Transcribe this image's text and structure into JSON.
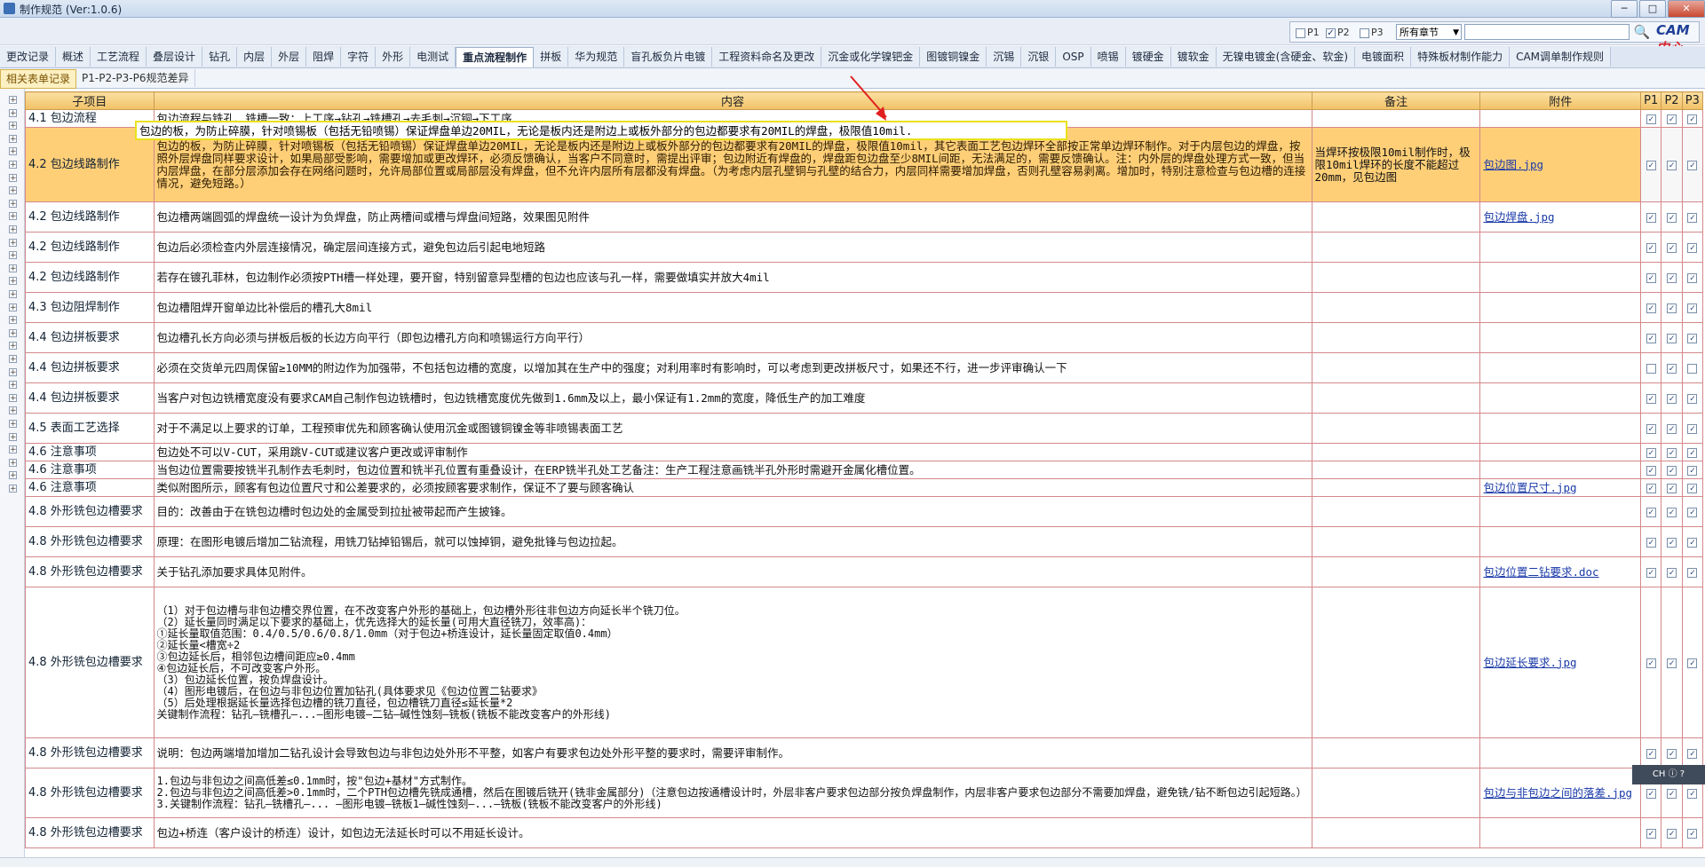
{
  "window": {
    "title": "制作规范 (Ver:1.0.6)",
    "minimize": "─",
    "maximize": "□",
    "close": "✕"
  },
  "filter": {
    "p1_label": "P1",
    "p2_label": "P2",
    "p3_label": "P3",
    "p1_checked": false,
    "p2_checked": true,
    "p3_checked": false,
    "chapter_select": "所有章节",
    "search_value": "",
    "brand": "CAM",
    "brand_zh": "中心"
  },
  "main_tabs": [
    "更改记录",
    "概述",
    "工艺流程",
    "叠层设计",
    "钻孔",
    "内层",
    "外层",
    "阻焊",
    "字符",
    "外形",
    "电测试",
    "重点流程制作",
    "拼板",
    "华为规范",
    "盲孔板负片电镀",
    "工程资料命名及更改",
    "沉金或化学镍钯金",
    "图镀铜镍金",
    "沉锡",
    "沉银",
    "OSP",
    "喷锡",
    "镀硬金",
    "镀软金",
    "无镍电镀金(含硬金、软金)",
    "电镀面积",
    "特殊板材制作能力",
    "CAM调单制作规则"
  ],
  "active_main_tab": "重点流程制作",
  "sub_tabs": [
    "相关表单记录",
    "P1-P2-P3-P6规范差异"
  ],
  "active_sub_tab": "相关表单记录",
  "columns": {
    "sub": "子项目",
    "content": "内容",
    "note": "备注",
    "attach": "附件",
    "p1": "P1",
    "p2": "P2",
    "p3": "P3"
  },
  "tooltip": "包边的板，为防止碎膜，针对喷锡板（包括无铅喷锡）保证焊盘单边20MIL，无论是板内还是附边上或板外部分的包边都要求有20MIL的焊盘，极限值10mil.",
  "rows": [
    {
      "sub": "4.1 包边流程",
      "content": "包边流程与铣孔、铣槽一致：上工序→钻孔→铣槽孔→去毛刺→沉铜→下工序",
      "note": "",
      "attach": "",
      "p1": true,
      "p2": true,
      "p3": true
    },
    {
      "sub": "4.2 包边线路制作",
      "content": "包边的板，为防止碎膜，针对喷锡板（包括无铅喷锡）保证焊盘单边20MIL，无论是板内还是附边上或板外部分的包边都要求有20MIL的焊盘，极限值10mil，其它表面工艺包边焊环全部按正常单边焊环制作。对于内层包边的焊盘，按照外层焊盘同样要求设计，如果局部受影响，需要增加或更改焊环，必须反馈确认，当客户不同意时，需提出评审；包边附近有焊盘的，焊盘距包边盘至少8MIL间距，无法满足的，需要反馈确认。注：内外层的焊盘处理方式一致，但当内层焊盘，在部分层添加会存在网络问题时，允许局部位置或局部层没有焊盘，但不允许内层所有层都没有焊盘。（为考虑内层孔壁铜与孔壁的结合力，内层同样需要增加焊盘，否则孔壁容易剥离。增加时，特别注意检查与包边槽的连接情况，避免短路。）",
      "note": "当焊环按极限10mil制作时，极限10mil焊环的长度不能超过20mm，见包边图",
      "attach": "包边图.jpg",
      "p1": true,
      "p2": true,
      "p3": true
    },
    {
      "sub": "4.2 包边线路制作",
      "content": "包边槽两端圆弧的焊盘统一设计为负焊盘，防止两槽间或槽与焊盘间短路，效果图见附件",
      "note": "",
      "attach": "包边焊盘.jpg",
      "p1": true,
      "p2": true,
      "p3": true
    },
    {
      "sub": "4.2 包边线路制作",
      "content": "包边后必须检查内外层连接情况，确定层间连接方式，避免包边后引起电地短路",
      "note": "",
      "attach": "",
      "p1": true,
      "p2": true,
      "p3": true
    },
    {
      "sub": "4.2 包边线路制作",
      "content": "若存在镀孔菲林，包边制作必须按PTH槽一样处理，要开窗，特别留意异型槽的包边也应该与孔一样，需要做填实并放大4mil",
      "note": "",
      "attach": "",
      "p1": true,
      "p2": true,
      "p3": true
    },
    {
      "sub": "4.3 包边阻焊制作",
      "content": "包边槽阻焊开窗单边比补偿后的槽孔大8mil",
      "note": "",
      "attach": "",
      "p1": true,
      "p2": true,
      "p3": true
    },
    {
      "sub": "4.4 包边拼板要求",
      "content": "包边槽孔长方向必须与拼板后板的长边方向平行（即包边槽孔方向和喷锡运行方向平行）",
      "note": "",
      "attach": "",
      "p1": true,
      "p2": true,
      "p3": true
    },
    {
      "sub": "4.4 包边拼板要求",
      "content": "必须在交货单元四周保留≥10MM的附边作为加强带，不包括包边槽的宽度，以增加其在生产中的强度；对利用率时有影响时，可以考虑到更改拼板尺寸，如果还不行，进一步评审确认一下",
      "note": "",
      "attach": "",
      "p1": false,
      "p2": true,
      "p3": false
    },
    {
      "sub": "4.4 包边拼板要求",
      "content": "当客户对包边铣槽宽度没有要求CAM自己制作包边铣槽时，包边铣槽宽度优先做到1.6mm及以上，最小保证有1.2mm的宽度，降低生产的加工难度",
      "note": "",
      "attach": "",
      "p1": true,
      "p2": true,
      "p3": true
    },
    {
      "sub": "4.5 表面工艺选择",
      "content": "对于不满足以上要求的订单，工程预审优先和顾客确认使用沉金或图镀铜镍金等非喷锡表面工艺",
      "note": "",
      "attach": "",
      "p1": true,
      "p2": true,
      "p3": true
    },
    {
      "sub": "4.6 注意事项",
      "content": "包边处不可以V-CUT，采用跳V-CUT或建议客户更改或评审制作",
      "note": "",
      "attach": "",
      "p1": true,
      "p2": true,
      "p3": true
    },
    {
      "sub": "4.6 注意事项",
      "content": "当包边位置需要按铣半孔制作去毛刺时，包边位置和铣半孔位置有重叠设计，在ERP铣半孔处工艺备注：生产工程注意画铣半孔外形时需避开金属化槽位置。",
      "note": "",
      "attach": "",
      "p1": true,
      "p2": true,
      "p3": true
    },
    {
      "sub": "4.6 注意事项",
      "content": "类似附图所示，顾客有包边位置尺寸和公差要求的，必须按顾客要求制作，保证不了要与顾客确认",
      "note": "",
      "attach": "包边位置尺寸.jpg",
      "p1": true,
      "p2": true,
      "p3": true
    },
    {
      "sub": "4.8 外形铣包边槽要求",
      "content": "目的：改善由于在铣包边槽时包边处的金属受到拉扯被带起而产生披锋。",
      "note": "",
      "attach": "",
      "p1": true,
      "p2": true,
      "p3": true
    },
    {
      "sub": "4.8 外形铣包边槽要求",
      "content": "原理：在图形电镀后增加二钻流程，用铣刀钻掉铅锡后，就可以蚀掉铜，避免批锋与包边拉起。",
      "note": "",
      "attach": "",
      "p1": true,
      "p2": true,
      "p3": true
    },
    {
      "sub": "4.8 外形铣包边槽要求",
      "content": "关于钻孔添加要求具体见附件。",
      "note": "",
      "attach": "包边位置二钻要求.doc",
      "p1": true,
      "p2": true,
      "p3": true
    },
    {
      "sub": "4.8 外形铣包边槽要求",
      "content": "（1）对于包边槽与非包边槽交界位置，在不改变客户外形的基础上，包边槽外形往非包边方向延长半个铣刀位。\n（2）延长量同时满足以下要求的基础上，优先选择大的延长量(可用大直径铣刀，效率高)：\n①延长量取值范围：0.4/0.5/0.6/0.8/1.0mm（对于包边+桥连设计，延长量固定取值0.4mm）\n②延长量<槽宽÷2\n③包边延长后，相邻包边槽间距应≥0.4mm\n④包边延长后，不可改变客户外形。\n（3）包边延长位置，按负焊盘设计。\n（4）图形电镀后，在包边与非包边位置加钻孔(具体要求见《包边位置二钻要求》\n（5）后处理根据延长量选择包边槽的铣刀直径，包边槽铣刀直径≤延长量*2\n关键制作流程：钻孔—铣槽孔—...—图形电镀—二钻—碱性蚀刻—铣板(铣板不能改变客户的外形线)",
      "note": "",
      "attach": "包边延长要求.jpg",
      "p1": true,
      "p2": true,
      "p3": true
    },
    {
      "sub": "4.8 外形铣包边槽要求",
      "content": "说明：包边两端增加增加二钻孔设计会导致包边与非包边处外形不平整，如客户有要求包边处外形平整的要求时，需要评审制作。",
      "note": "",
      "attach": "",
      "p1": true,
      "p2": true,
      "p3": true
    },
    {
      "sub": "4.8 外形铣包边槽要求",
      "content": "1.包边与非包边之间高低差≤0.1mm时，按\"包边+基材\"方式制作。\n2.包边与非包边之间高低差>0.1mm时，二个PTH包边槽先铣成通槽，然后在图镀后铣开(铣非金属部分)（注意包边按通槽设计时，外层非客户要求包边部分按负焊盘制作，内层非客户要求包边部分不需要加焊盘，避免铣/钻不断包边引起短路。）\n3.关键制作流程：钻孔—铣槽孔—... —图形电镀—铣板1—碱性蚀刻—...—铣板(铣板不能改变客户的外形线)",
      "note": "",
      "attach": "包边与非包边之间的落差.jpg",
      "p1": true,
      "p2": true,
      "p3": true
    },
    {
      "sub": "4.8 外形铣包边槽要求",
      "content": "包边+桥连（客户设计的桥连）设计，如包边无法延长时可以不用延长设计。",
      "note": "",
      "attach": "",
      "p1": true,
      "p2": true,
      "p3": true
    }
  ],
  "overlay": {
    "label": "CH ⓘ ?"
  }
}
